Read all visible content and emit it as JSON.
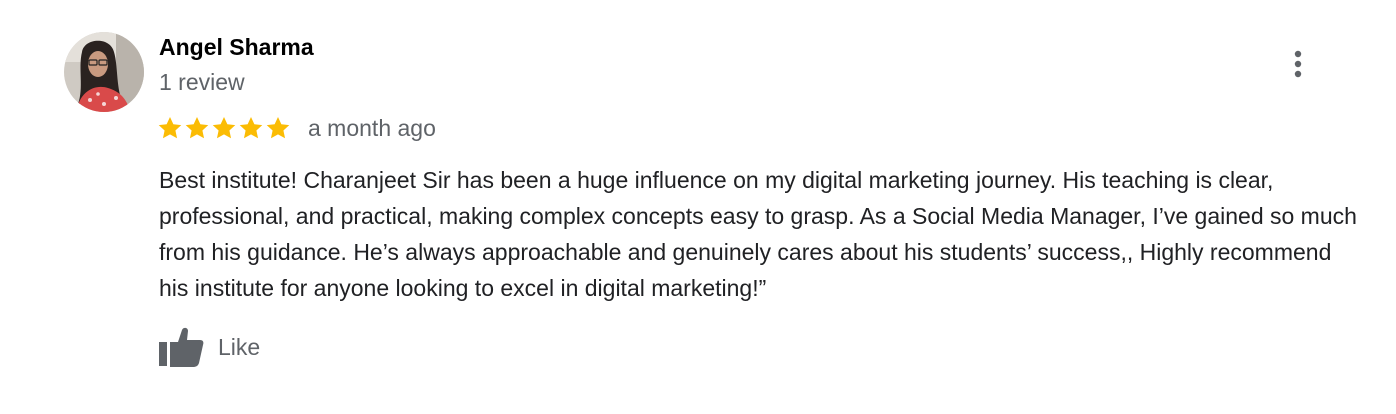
{
  "review": {
    "reviewer_name": "Angel Sharma",
    "review_count": "1 review",
    "rating": 5,
    "rating_max": 5,
    "date": "a month ago",
    "text": "Best institute! Charanjeet Sir has been a huge influence on my digital marketing journey. His teaching is clear, professional, and practical, making complex concepts easy to grasp. As a Social Media Manager, I’ve gained so much from his guidance. He’s always approachable and genuinely cares about his students’ success,, Highly recommend his institute for anyone looking to excel in digital marketing!”",
    "like_label": "Like"
  },
  "icons": {
    "avatar": "avatar-photo",
    "more": "more-vertical-icon",
    "star": "star-icon",
    "like": "thumbs-up-icon"
  },
  "colors": {
    "star": "#fbbc04",
    "name": "#000000",
    "secondary_text": "#5f6368",
    "body_text": "#202124",
    "icon": "#5f6368"
  }
}
